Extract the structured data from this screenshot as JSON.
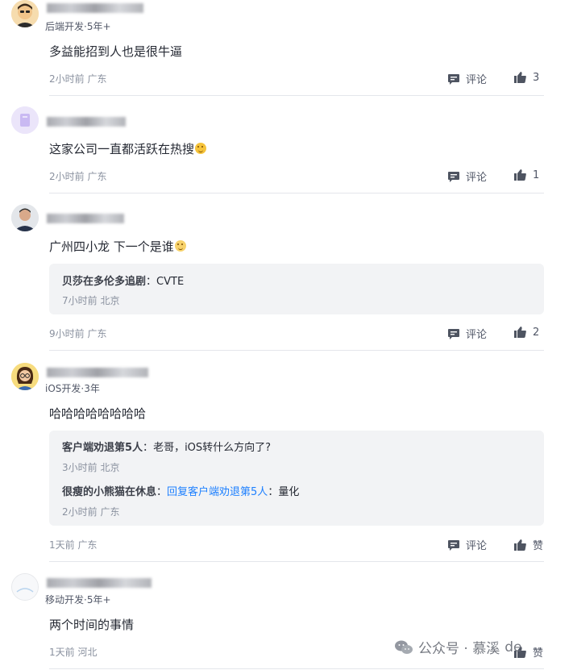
{
  "comments": [
    {
      "meta": "后端开发·5年+",
      "content": "多益能招到人也是很牛逼",
      "time": "2小时前 广东",
      "comment_label": "评论",
      "like_count": "3",
      "avatar_icon": "cartoon-person-avatar-icon"
    },
    {
      "meta": "",
      "content": "这家公司一直都活跃在热搜",
      "emoji": "laugh-emoji-icon",
      "time": "2小时前 广东",
      "comment_label": "评论",
      "like_count": "1",
      "avatar_icon": "purple-default-avatar-icon"
    },
    {
      "meta": "",
      "content": "广州四小龙 下一个是谁",
      "emoji": "grimace-emoji-icon",
      "replies": [
        {
          "name": "贝莎在多伦多追剧",
          "separator": "：",
          "text": "CVTE",
          "time": "7小时前 北京"
        }
      ],
      "time": "9小时前 广东",
      "comment_label": "评论",
      "like_count": "2",
      "avatar_icon": "man-portrait-avatar-icon"
    },
    {
      "meta": "iOS开发·3年",
      "content": "哈哈哈哈哈哈哈哈",
      "replies": [
        {
          "name": "客户端劝退第5人",
          "separator": "：",
          "text": "老哥，iOS转什么方向了?",
          "time": "3小时前 北京"
        },
        {
          "name": "很瘦的小熊猫在休息",
          "separator": "：",
          "reply_to": "回复客户端劝退第5人",
          "reply_sep": "：",
          "text": "量化",
          "time": "2小时前 广东"
        }
      ],
      "time": "1天前 广东",
      "comment_label": "评论",
      "like_label": "赞",
      "avatar_icon": "girl-glasses-avatar-icon"
    },
    {
      "meta": "移动开发·5年+",
      "content": "两个时间的事情",
      "time": "1天前 河北",
      "like_label": "赞",
      "avatar_icon": "white-default-avatar-icon"
    }
  ],
  "watermark": {
    "text": "公众号 · 慕溪",
    "suffix": "de",
    "icon": "wechat-icon"
  },
  "colors": {
    "text": "#252933",
    "secondary": "#8a919f",
    "link": "#1e80ff",
    "reply_bg": "#f2f3f5"
  }
}
